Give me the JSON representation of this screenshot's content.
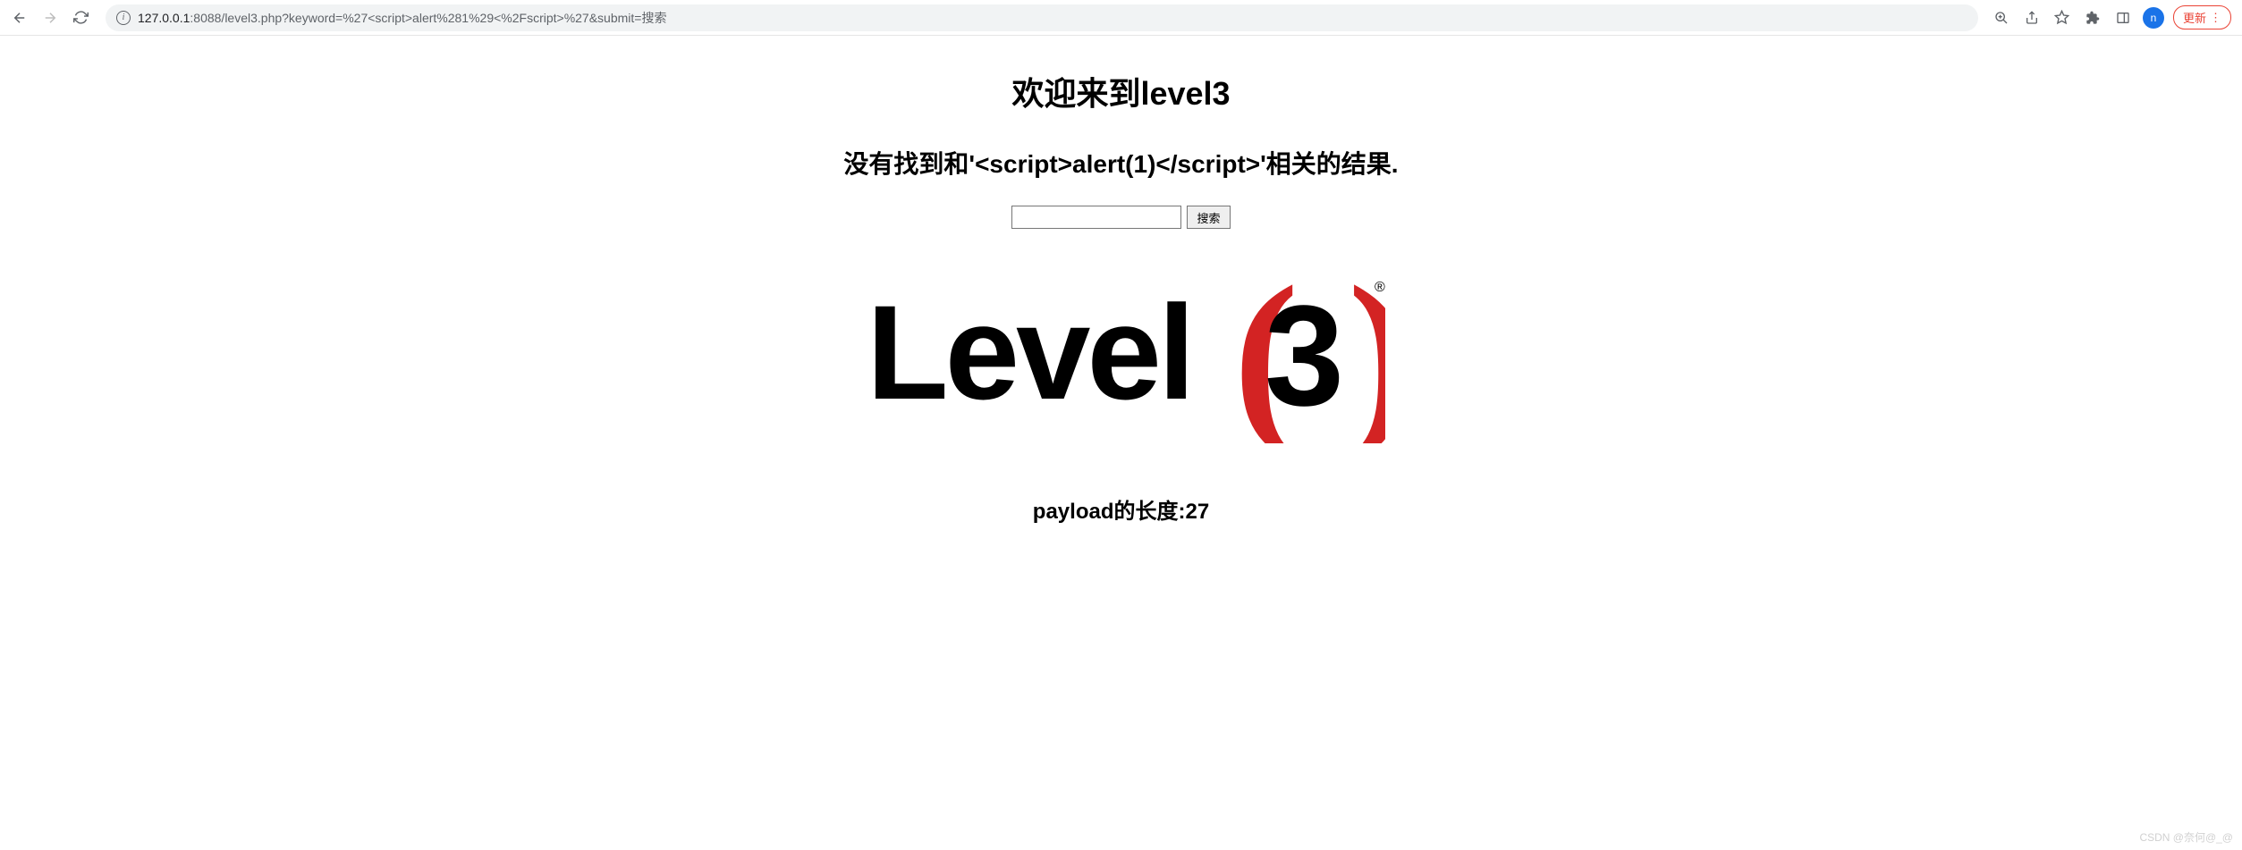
{
  "browser": {
    "url_host": "127.0.0.1",
    "url_rest": ":8088/level3.php?keyword=%27<script>alert%281%29<%2Fscript>%27&submit=搜索",
    "avatar_letter": "n",
    "update_label": "更新"
  },
  "page": {
    "title": "欢迎来到level3",
    "result_msg": "没有找到和'<script>alert(1)</script>'相关的结果.",
    "search_value": "",
    "search_button_label": "搜索",
    "logo_text_level": "Level",
    "logo_text_three": "3",
    "logo_registered": "®",
    "payload_text": "payload的长度:27"
  },
  "watermark": "CSDN @奈何@_@",
  "colors": {
    "logo_red": "#d32323",
    "update_red": "#ea4335",
    "avatar_blue": "#1a73e8"
  }
}
